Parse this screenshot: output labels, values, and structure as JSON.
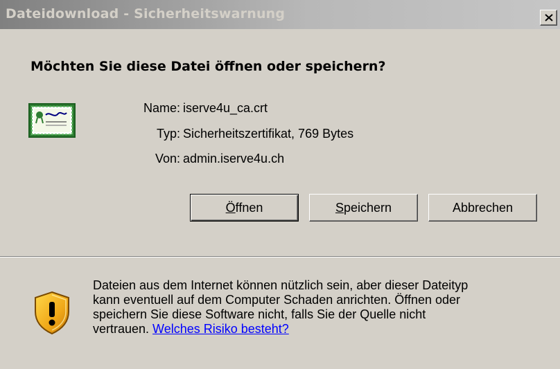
{
  "window": {
    "title": "Dateidownload - Sicherheitswarnung"
  },
  "heading": "Möchten Sie diese Datei öffnen oder speichern?",
  "details": {
    "name_label": "Name:",
    "name_value": "iserve4u_ca.crt",
    "type_label": "Typ:",
    "type_value": "Sicherheitszertifikat, 769 Bytes",
    "from_label": "Von:",
    "from_value": "admin.iserve4u.ch"
  },
  "buttons": {
    "open": {
      "before": "",
      "accel": "Ö",
      "after": "ffnen"
    },
    "save": {
      "before": "",
      "accel": "S",
      "after": "peichern"
    },
    "cancel": {
      "label": "Abbrechen"
    }
  },
  "warning": {
    "lines": [
      "Dateien aus dem Internet können nützlich sein, aber dieser Dateityp",
      "kann eventuell auf dem Computer Schaden anrichten. Öffnen oder",
      "speichern Sie diese Software nicht, falls Sie der Quelle nicht"
    ],
    "last_line_prefix": "vertrauen. ",
    "link_text": "Welches Risiko besteht?"
  },
  "icons": {
    "close": "close-icon",
    "certificate": "certificate-icon",
    "shield": "warning-shield-icon"
  },
  "colors": {
    "dialog_bg": "#d4d0c8",
    "title_text": "#d4d0c8",
    "link": "#0000ff",
    "shield": "#e8a417"
  }
}
